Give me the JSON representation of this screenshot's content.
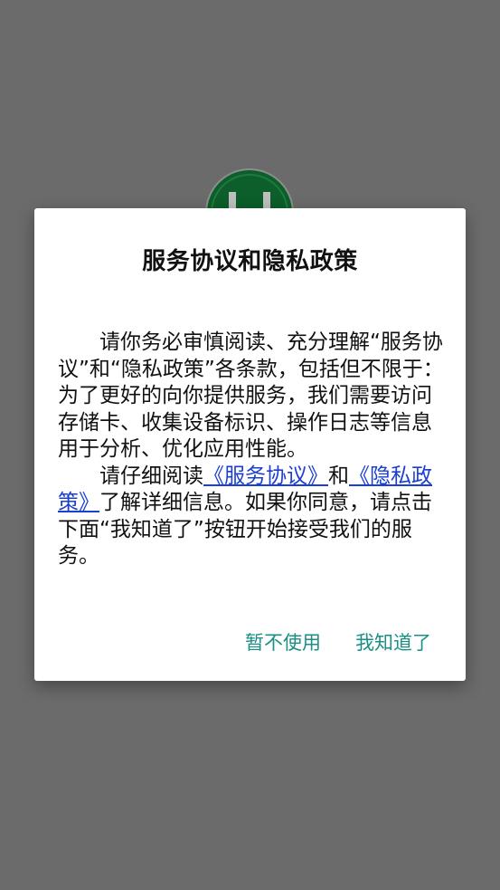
{
  "background_color": "#6b6b6b",
  "logo": {
    "icon": "app-logo-icon",
    "color": "#0c5e2a"
  },
  "dialog": {
    "title": "服务协议和隐私政策",
    "paragraph1": "请你务必审慎阅读、充分理解“服务协议”和“隐私政策”各条款，包括但不限于：为了更好的向你提供服务，我们需要访问存储卡、收集设备标识、操作日志等信息用于分析、优化应用性能。",
    "paragraph2_prefix": "请仔细阅读",
    "link_service": "《服务协议》",
    "paragraph2_and": "和",
    "link_privacy": "《隐私政策》",
    "paragraph2_suffix": "了解详细信息。如果你同意，请点击下面“我知道了”按钮开始接受我们的服务。",
    "cancel_label": "暂不使用",
    "confirm_label": "我知道了",
    "accent_color": "#1a8f85",
    "link_color": "#1a3fd1"
  }
}
